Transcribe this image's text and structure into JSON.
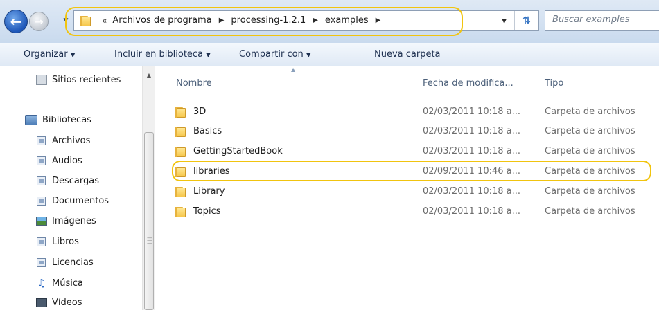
{
  "address_bar": {
    "overflow_chevron": "«",
    "breadcrumbs": [
      "Archivos de programa",
      "processing-1.2.1",
      "examples"
    ],
    "search_placeholder": "Buscar examples"
  },
  "toolbar": {
    "organize": "Organizar",
    "include_library": "Incluir en biblioteca",
    "share_with": "Compartir con",
    "new_folder": "Nueva carpeta"
  },
  "navigation": {
    "items": [
      {
        "label": "Sitios recientes",
        "icon": "recent-places-icon"
      },
      {
        "label": "Bibliotecas",
        "icon": "libraries-icon"
      },
      {
        "label": "Archivos",
        "icon": "library-icon"
      },
      {
        "label": "Audios",
        "icon": "library-icon"
      },
      {
        "label": "Descargas",
        "icon": "library-icon"
      },
      {
        "label": "Documentos",
        "icon": "documents-icon"
      },
      {
        "label": "Imágenes",
        "icon": "pictures-icon"
      },
      {
        "label": "Libros",
        "icon": "library-icon"
      },
      {
        "label": "Licencias",
        "icon": "library-icon"
      },
      {
        "label": "Música",
        "icon": "music-icon"
      },
      {
        "label": "Vídeos",
        "icon": "videos-icon"
      }
    ]
  },
  "file_list": {
    "columns": {
      "name": "Nombre",
      "date": "Fecha de modifica...",
      "type": "Tipo"
    },
    "rows": [
      {
        "name": "3D",
        "date": "02/03/2011 10:18 a...",
        "type": "Carpeta de archivos"
      },
      {
        "name": "Basics",
        "date": "02/03/2011 10:18 a...",
        "type": "Carpeta de archivos"
      },
      {
        "name": "GettingStartedBook",
        "date": "02/03/2011 10:18 a...",
        "type": "Carpeta de archivos"
      },
      {
        "name": "libraries",
        "date": "02/09/2011 10:46 a...",
        "type": "Carpeta de archivos"
      },
      {
        "name": "Library",
        "date": "02/03/2011 10:18 a...",
        "type": "Carpeta de archivos"
      },
      {
        "name": "Topics",
        "date": "02/03/2011 10:18 a...",
        "type": "Carpeta de archivos"
      }
    ]
  },
  "colors": {
    "highlight": "#f1c40f",
    "folder": "#f6c74c"
  }
}
